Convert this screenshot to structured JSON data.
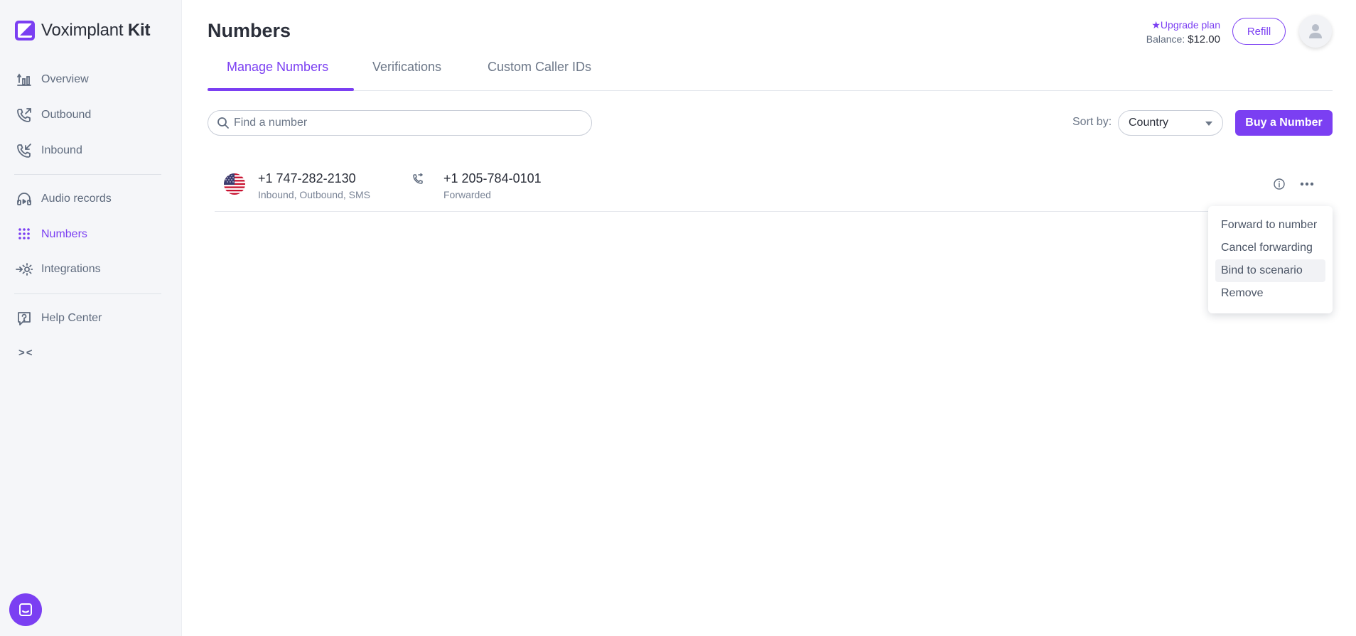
{
  "app": {
    "name_regular": "Voximplant",
    "name_bold": "Kit"
  },
  "sidebar": {
    "items": [
      {
        "label": "Overview",
        "icon": "overview-chart-icon"
      },
      {
        "label": "Outbound",
        "icon": "outbound-call-icon"
      },
      {
        "label": "Inbound",
        "icon": "inbound-call-icon"
      },
      {
        "label": "Audio records",
        "icon": "headphones-icon"
      },
      {
        "label": "Numbers",
        "icon": "keypad-icon",
        "active": true
      },
      {
        "label": "Integrations",
        "icon": "integrations-gear-icon"
      },
      {
        "label": "Help Center",
        "icon": "help-icon"
      }
    ],
    "collapse_label": "><"
  },
  "header": {
    "title": "Numbers",
    "upgrade_label": "★Upgrade plan",
    "balance_label": "Balance:",
    "balance_value": "$12.00",
    "refill_label": "Refill"
  },
  "tabs": [
    {
      "label": "Manage Numbers",
      "active": true
    },
    {
      "label": "Verifications"
    },
    {
      "label": "Custom Caller IDs"
    }
  ],
  "toolbar": {
    "search_placeholder": "Find a number",
    "sort_label": "Sort by:",
    "sort_value": "Country",
    "buy_label": "Buy a Number"
  },
  "numbers": [
    {
      "number": "+1 747-282-2130",
      "capabilities": "Inbound, Outbound, SMS",
      "forward_number": "+1 205-784-0101",
      "forward_status": "Forwarded",
      "country_icon": "us-flag-icon"
    }
  ],
  "context_menu": {
    "items": [
      {
        "label": "Forward to number"
      },
      {
        "label": "Cancel forwarding"
      },
      {
        "label": "Bind to scenario",
        "hovered": true
      },
      {
        "label": "Remove"
      }
    ]
  },
  "colors": {
    "accent": "#7b3ff2",
    "sidebar_bg": "#f5f6f9",
    "text_muted": "#6c7788"
  }
}
